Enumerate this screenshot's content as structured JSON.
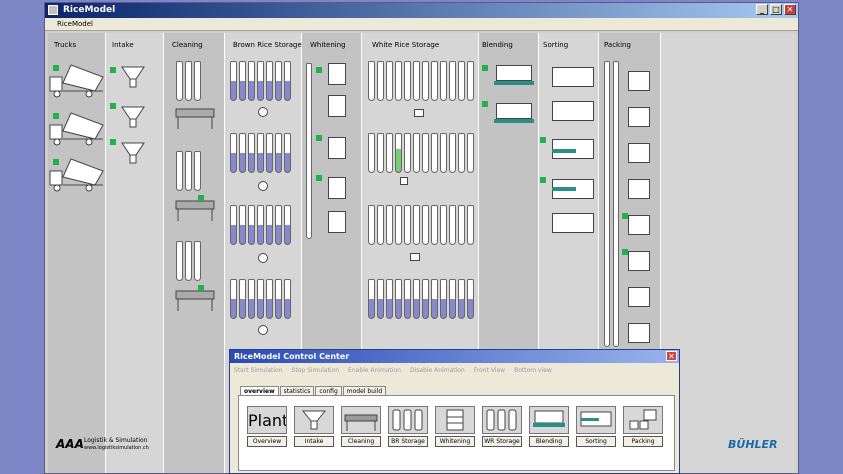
{
  "window": {
    "title": "RiceModel",
    "menu": "RiceModel",
    "min": "_",
    "max": "□",
    "close": "✕"
  },
  "columns": [
    {
      "label": "Trucks"
    },
    {
      "label": "Intake"
    },
    {
      "label": "Cleaning"
    },
    {
      "label": "Brown Rice Storage"
    },
    {
      "label": "Whitening"
    },
    {
      "label": "White Rice Storage"
    },
    {
      "label": "Blending"
    },
    {
      "label": "Sorting"
    },
    {
      "label": "Packing"
    }
  ],
  "logos": {
    "aaa": "AAA",
    "aaa_line1": "Logistik & Simulation",
    "aaa_line2": "www.logistiksimulation.ch",
    "buhler": "BÜHLER"
  },
  "control_center": {
    "title": "RiceModel Control Center",
    "close": "✕",
    "menu": [
      "Start Simulation",
      "Stop Simulation",
      "Enable Animation",
      "Disable Animation",
      "Front View",
      "Bottom view"
    ],
    "tabs": [
      "overview",
      "statistics",
      "config",
      "model build"
    ],
    "active_tab": "overview",
    "plant_word": "Plant",
    "tiles": [
      "Overview",
      "Intake",
      "Cleaning",
      "BR Storage",
      "Whitening",
      "WR Storage",
      "Blending",
      "Sorting",
      "Packing"
    ]
  },
  "colors": {
    "accent_green": "#22b14c",
    "brown_rice": "#8888cc",
    "teal": "#2a8f86"
  }
}
